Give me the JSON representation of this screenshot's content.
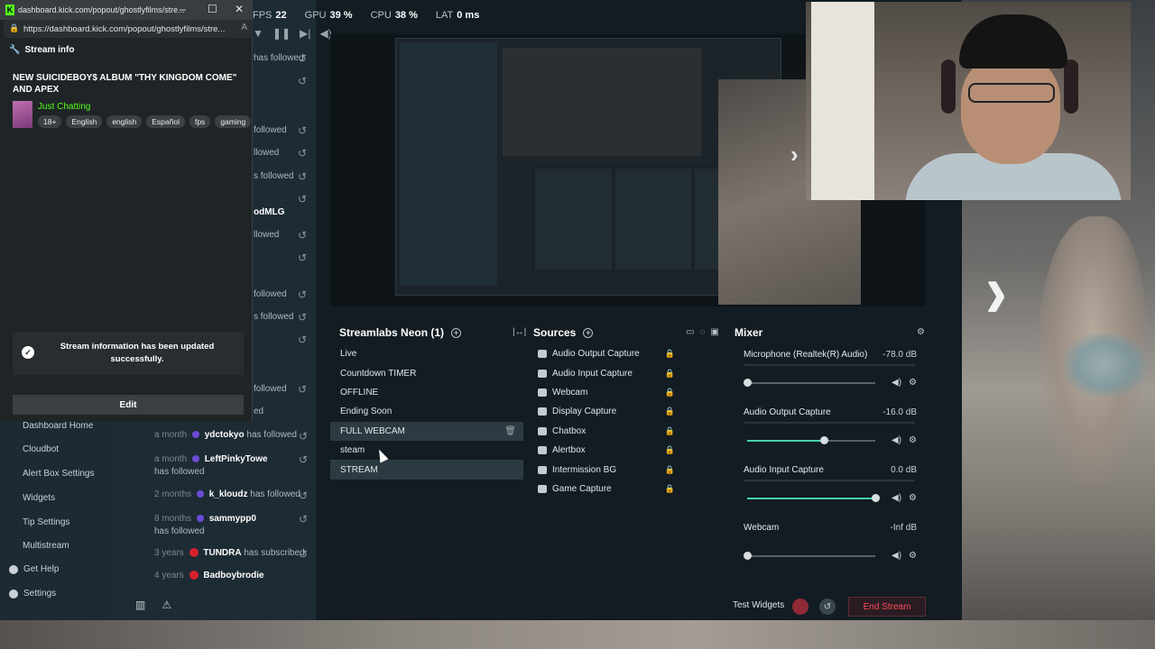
{
  "browser": {
    "title": "dashboard.kick.com/popout/ghostlyfilms/stre...",
    "url": "https://dashboard.kick.com/popout/ghostlyfilms/stre...",
    "favicon": "K"
  },
  "stream_info": {
    "header": "Stream info",
    "title": "NEW SUICIDEBOY$ ALBUM \"THY KINGDOM COME\" AND APEX",
    "category": "Just Chatting",
    "tags": [
      "18+",
      "English",
      "english",
      "Español",
      "fps",
      "gaming"
    ],
    "toast": "Stream information has been updated successfully.",
    "edit_label": "Edit"
  },
  "stats": {
    "fps_label": "FPS",
    "fps": "22",
    "gpu_label": "GPU",
    "gpu": "39 %",
    "cpu_label": "CPU",
    "cpu": "38 %",
    "lat_label": "LAT",
    "lat": "0 ms"
  },
  "sidebar": {
    "items": [
      "Dashboard Home",
      "Cloudbot",
      "Alert Box Settings",
      "Widgets",
      "Tip Settings",
      "Multistream"
    ],
    "get_help": "Get Help",
    "settings": "Settings"
  },
  "feed_partials": {
    "a": "has followed",
    "b": "followed",
    "c": "llowed",
    "d": "s followed",
    "e": "odMLG",
    "f": "llowed",
    "g": "followed",
    "h": "s followed",
    "i": "followed",
    "j": "ed"
  },
  "feed": [
    {
      "time": "a month",
      "name": "ydctokyo",
      "action": "has followed"
    },
    {
      "time": "a month",
      "name": "LeftPinkyTowe",
      "action": "has followed"
    },
    {
      "time": "2 months",
      "name": "k_kloudz",
      "action": "has followed"
    },
    {
      "time": "8 months",
      "name": "sammypp0",
      "action": "has followed"
    },
    {
      "time": "3 years",
      "name": "TUNDRA",
      "action": "has subscribed"
    },
    {
      "time": "4 years",
      "name": "Badboybrodie",
      "action": ""
    }
  ],
  "scenes": {
    "header": "Streamlabs Neon (1)",
    "items": [
      "Live",
      "Countdown TIMER",
      "OFFLINE",
      "Ending Soon",
      "FULL WEBCAM",
      "steam",
      "STREAM"
    ]
  },
  "sources": {
    "header": "Sources",
    "items": [
      "Audio Output Capture",
      "Audio Input Capture",
      "Webcam",
      "Display Capture",
      "Chatbox",
      "Alertbox",
      "Intermission BG",
      "Game Capture"
    ]
  },
  "mixer": {
    "header": "Mixer",
    "channels": [
      {
        "name": "Microphone (Realtek(R) Audio)",
        "db": "-78.0 dB",
        "level": 0.0
      },
      {
        "name": "Audio Output Capture",
        "db": "-16.0 dB",
        "level": 0.6
      },
      {
        "name": "Audio Input Capture",
        "db": "0.0 dB",
        "level": 1.0
      },
      {
        "name": "Webcam",
        "db": "-Inf dB",
        "level": 0.0
      }
    ]
  },
  "bottom": {
    "test_widgets": "Test Widgets",
    "end_stream": "End Stream"
  },
  "colors": {
    "kick_green": "#53fc18",
    "accent_teal": "#45d0a9",
    "end_red": "#ff4b5c"
  }
}
